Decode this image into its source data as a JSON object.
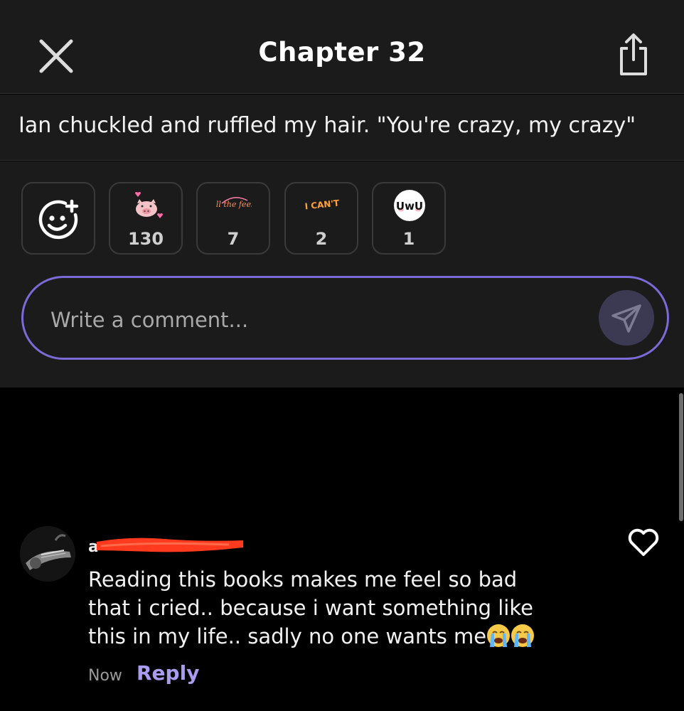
{
  "header": {
    "title": "Chapter 32",
    "close_icon": "close-icon",
    "share_icon": "share-icon"
  },
  "quote": {
    "text": "Ian chuckled and ruffled my hair. \"You're crazy, my crazy\""
  },
  "reactions": {
    "add_icon": "add-reaction-icon",
    "items": [
      {
        "icon": "pig-sticker-icon",
        "count": "130"
      },
      {
        "icon": "all-the-feels-sticker-icon",
        "sticker_text": "All the feels",
        "count": "7"
      },
      {
        "icon": "i-cant-sticker-icon",
        "sticker_text": "I CAN'T",
        "count": "2"
      },
      {
        "icon": "uwu-sticker-icon",
        "sticker_text": "UwU",
        "count": "1"
      }
    ]
  },
  "composer": {
    "placeholder": "Write a comment...",
    "send_icon": "send-icon"
  },
  "comment": {
    "username_visible": "a",
    "text": "Reading this books makes me feel so bad that i cried.. because i want something like this in my life.. sadly no one wants me",
    "emojis": [
      "loudly-crying-face-icon",
      "loudly-crying-face-icon"
    ],
    "time": "Now",
    "reply_label": "Reply",
    "like_icon": "heart-icon"
  },
  "colors": {
    "background": "#000000",
    "panel": "#1b1b1b",
    "accent": "#7b6bd6",
    "reply": "#a99cf0"
  }
}
